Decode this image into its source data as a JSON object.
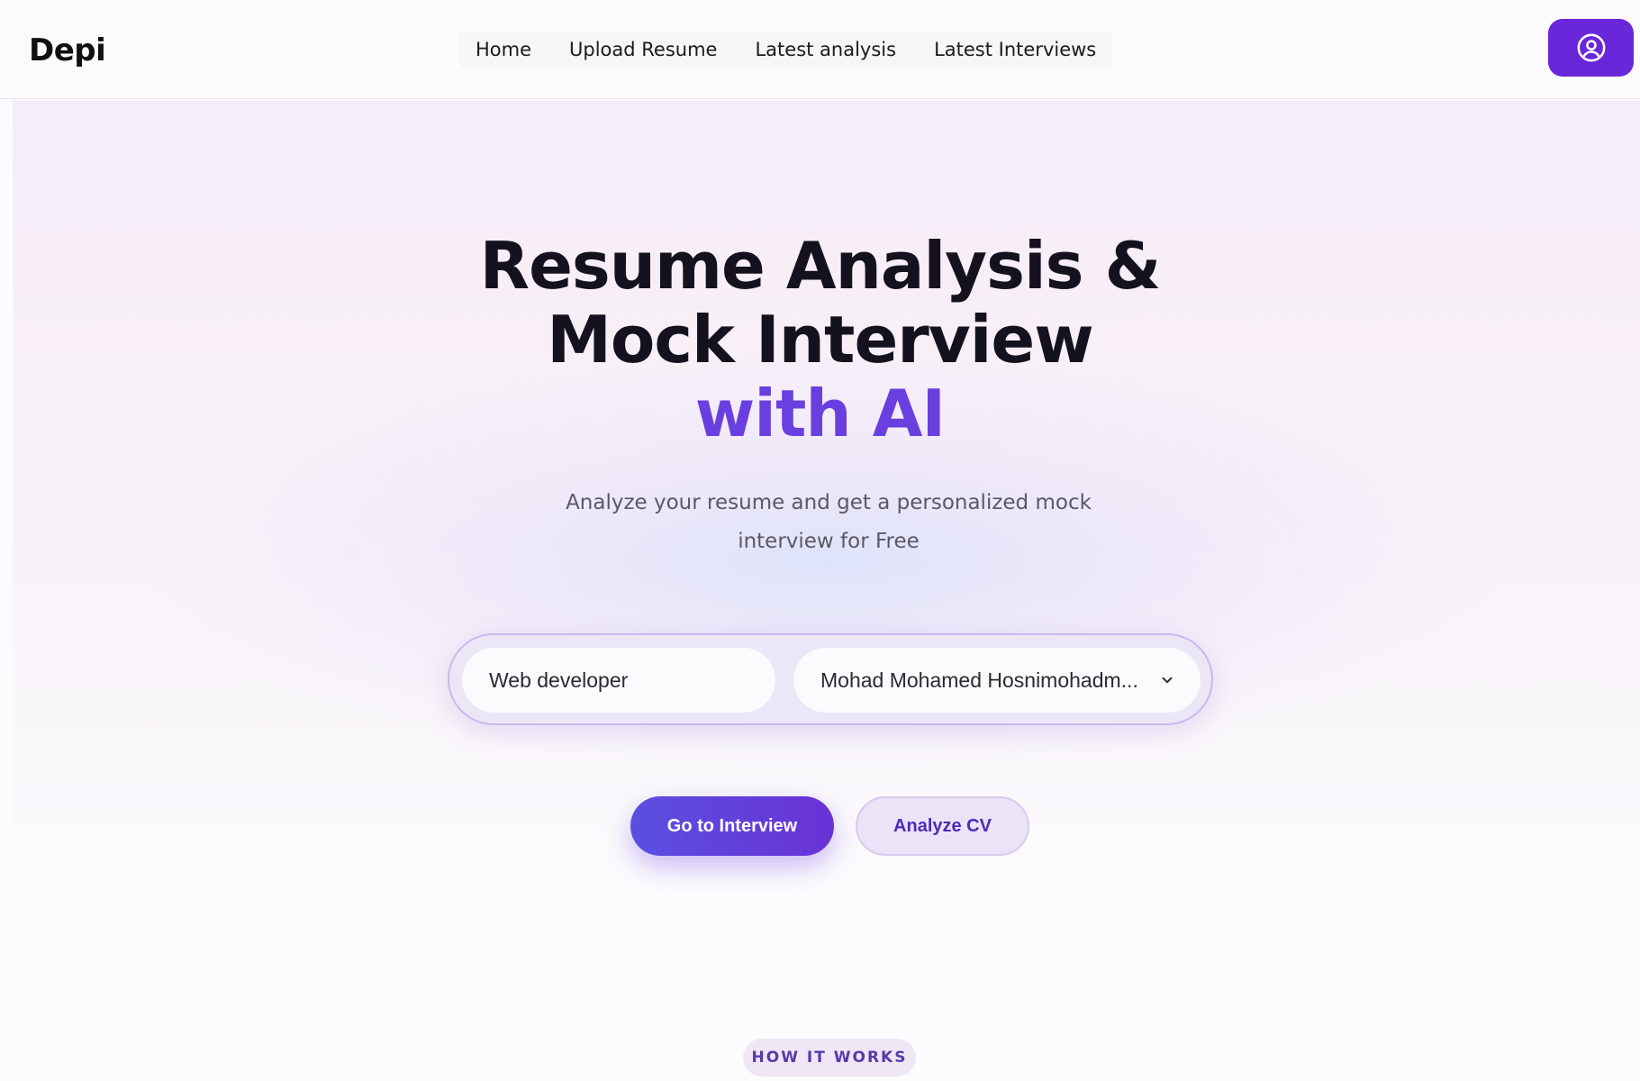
{
  "header": {
    "brand": "Depi",
    "nav": [
      "Home",
      "Upload Resume",
      "Latest analysis",
      "Latest Interviews"
    ],
    "profile_icon": "user-circle-icon"
  },
  "hero": {
    "title_line1": "Resume Analysis &",
    "title_line2": "Mock Interview",
    "title_accent": "with AI",
    "subtitle_line1": "Analyze your resume and get a personalized mock",
    "subtitle_line2": "interview for Free"
  },
  "search": {
    "role_value": "Web developer",
    "resume_selected": "Mohad Mohamed Hosnimohadm..."
  },
  "actions": {
    "primary_label": "Go to Interview",
    "secondary_label": "Analyze CV"
  },
  "section_badge": "HOW IT WORKS",
  "colors": {
    "accent": "#6a26d9",
    "title_accent": "#6a3fe0",
    "primary_button": "#5a4fe0"
  }
}
